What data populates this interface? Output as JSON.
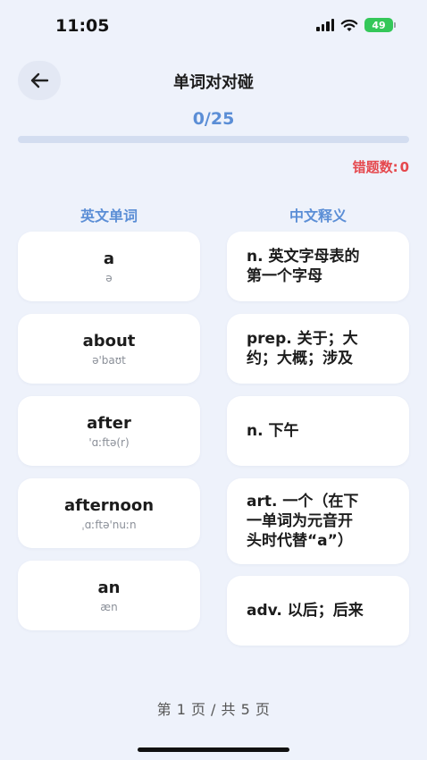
{
  "status_bar": {
    "time": "11:05",
    "battery": "49"
  },
  "header": {
    "title": "单词对对碰"
  },
  "progress": {
    "text": "0/25",
    "fraction": 0
  },
  "errors": {
    "label": "错题数:",
    "count": "0"
  },
  "columns": {
    "english": "英文单词",
    "chinese": "中文释义"
  },
  "words": [
    {
      "word": "a",
      "phonetic": "ə"
    },
    {
      "word": "about",
      "phonetic": "ə'baʊt"
    },
    {
      "word": "after",
      "phonetic": "'ɑːftə(r)"
    },
    {
      "word": "afternoon",
      "phonetic": "ˌɑːftə'nuːn"
    },
    {
      "word": "an",
      "phonetic": "æn"
    }
  ],
  "meanings": [
    {
      "line1": "n. 英文字母表的",
      "line2": "第一个字母",
      "line3": ""
    },
    {
      "line1": "prep. 关于；大",
      "line2": "约；大概；涉及",
      "line3": ""
    },
    {
      "line1": "n. 下午",
      "line2": "",
      "line3": ""
    },
    {
      "line1": "art. 一个（在下",
      "line2": "一单词为元音开",
      "line3": "头时代替“a”）"
    },
    {
      "line1": "adv. 以后；后来",
      "line2": "",
      "line3": ""
    }
  ],
  "pagination": {
    "text": "第 1 页 / 共 5 页"
  }
}
